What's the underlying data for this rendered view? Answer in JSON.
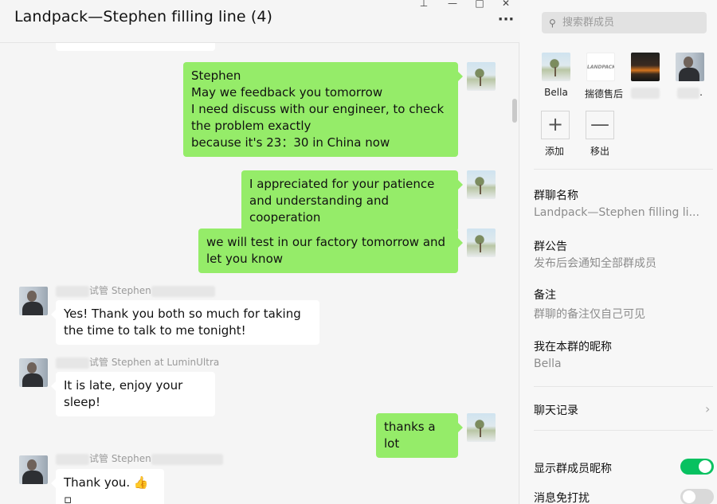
{
  "chat": {
    "title": "Landpack—Stephen filling line (4)",
    "messages": [
      {
        "from": "me",
        "text": "Stephen\nMay we feedback you tomorrow\nI need discuss with our engineer, to check the problem exactly\nbecause it's 23：30 in China now"
      },
      {
        "from": "me",
        "text": "I appreciated for your patience and understanding and cooperation"
      },
      {
        "from": "me",
        "text": "we will test in our factory tomorrow and let you know"
      },
      {
        "from": "other",
        "sender": "试管 Stephen",
        "text": "Yes! Thank you both so much for taking the time to talk to me tonight!"
      },
      {
        "from": "other",
        "sender": "试管 Stephen at LuminUltra",
        "text": "It is late, enjoy your sleep!"
      },
      {
        "from": "me",
        "text": "thanks a lot"
      },
      {
        "from": "other",
        "sender": "试管 Stephen",
        "text": "Thank you. 👍▫"
      }
    ]
  },
  "side": {
    "search_placeholder": "搜索群成员",
    "members": [
      {
        "name": "Bella"
      },
      {
        "name": "揣德售后",
        "logo_text": "LANDPACK"
      },
      {
        "name": ""
      },
      {
        "name": "."
      }
    ],
    "add_label": "添加",
    "remove_label": "移出",
    "group_name_label": "群聊名称",
    "group_name_value": "Landpack—Stephen filling li...",
    "announcement_label": "群公告",
    "announcement_value": "发布后会通知全部群成员",
    "remark_label": "备注",
    "remark_value": "群聊的备注仅自己可见",
    "nickname_label": "我在本群的昵称",
    "nickname_value": "Bella",
    "history_label": "聊天记录",
    "show_nickname_label": "显示群成员昵称",
    "show_nickname_on": true,
    "mute_label": "消息免打扰",
    "mute_on": false
  },
  "colors": {
    "my_bubble": "#95ec69",
    "other_bubble": "#ffffff",
    "toggle_on": "#07c160"
  }
}
